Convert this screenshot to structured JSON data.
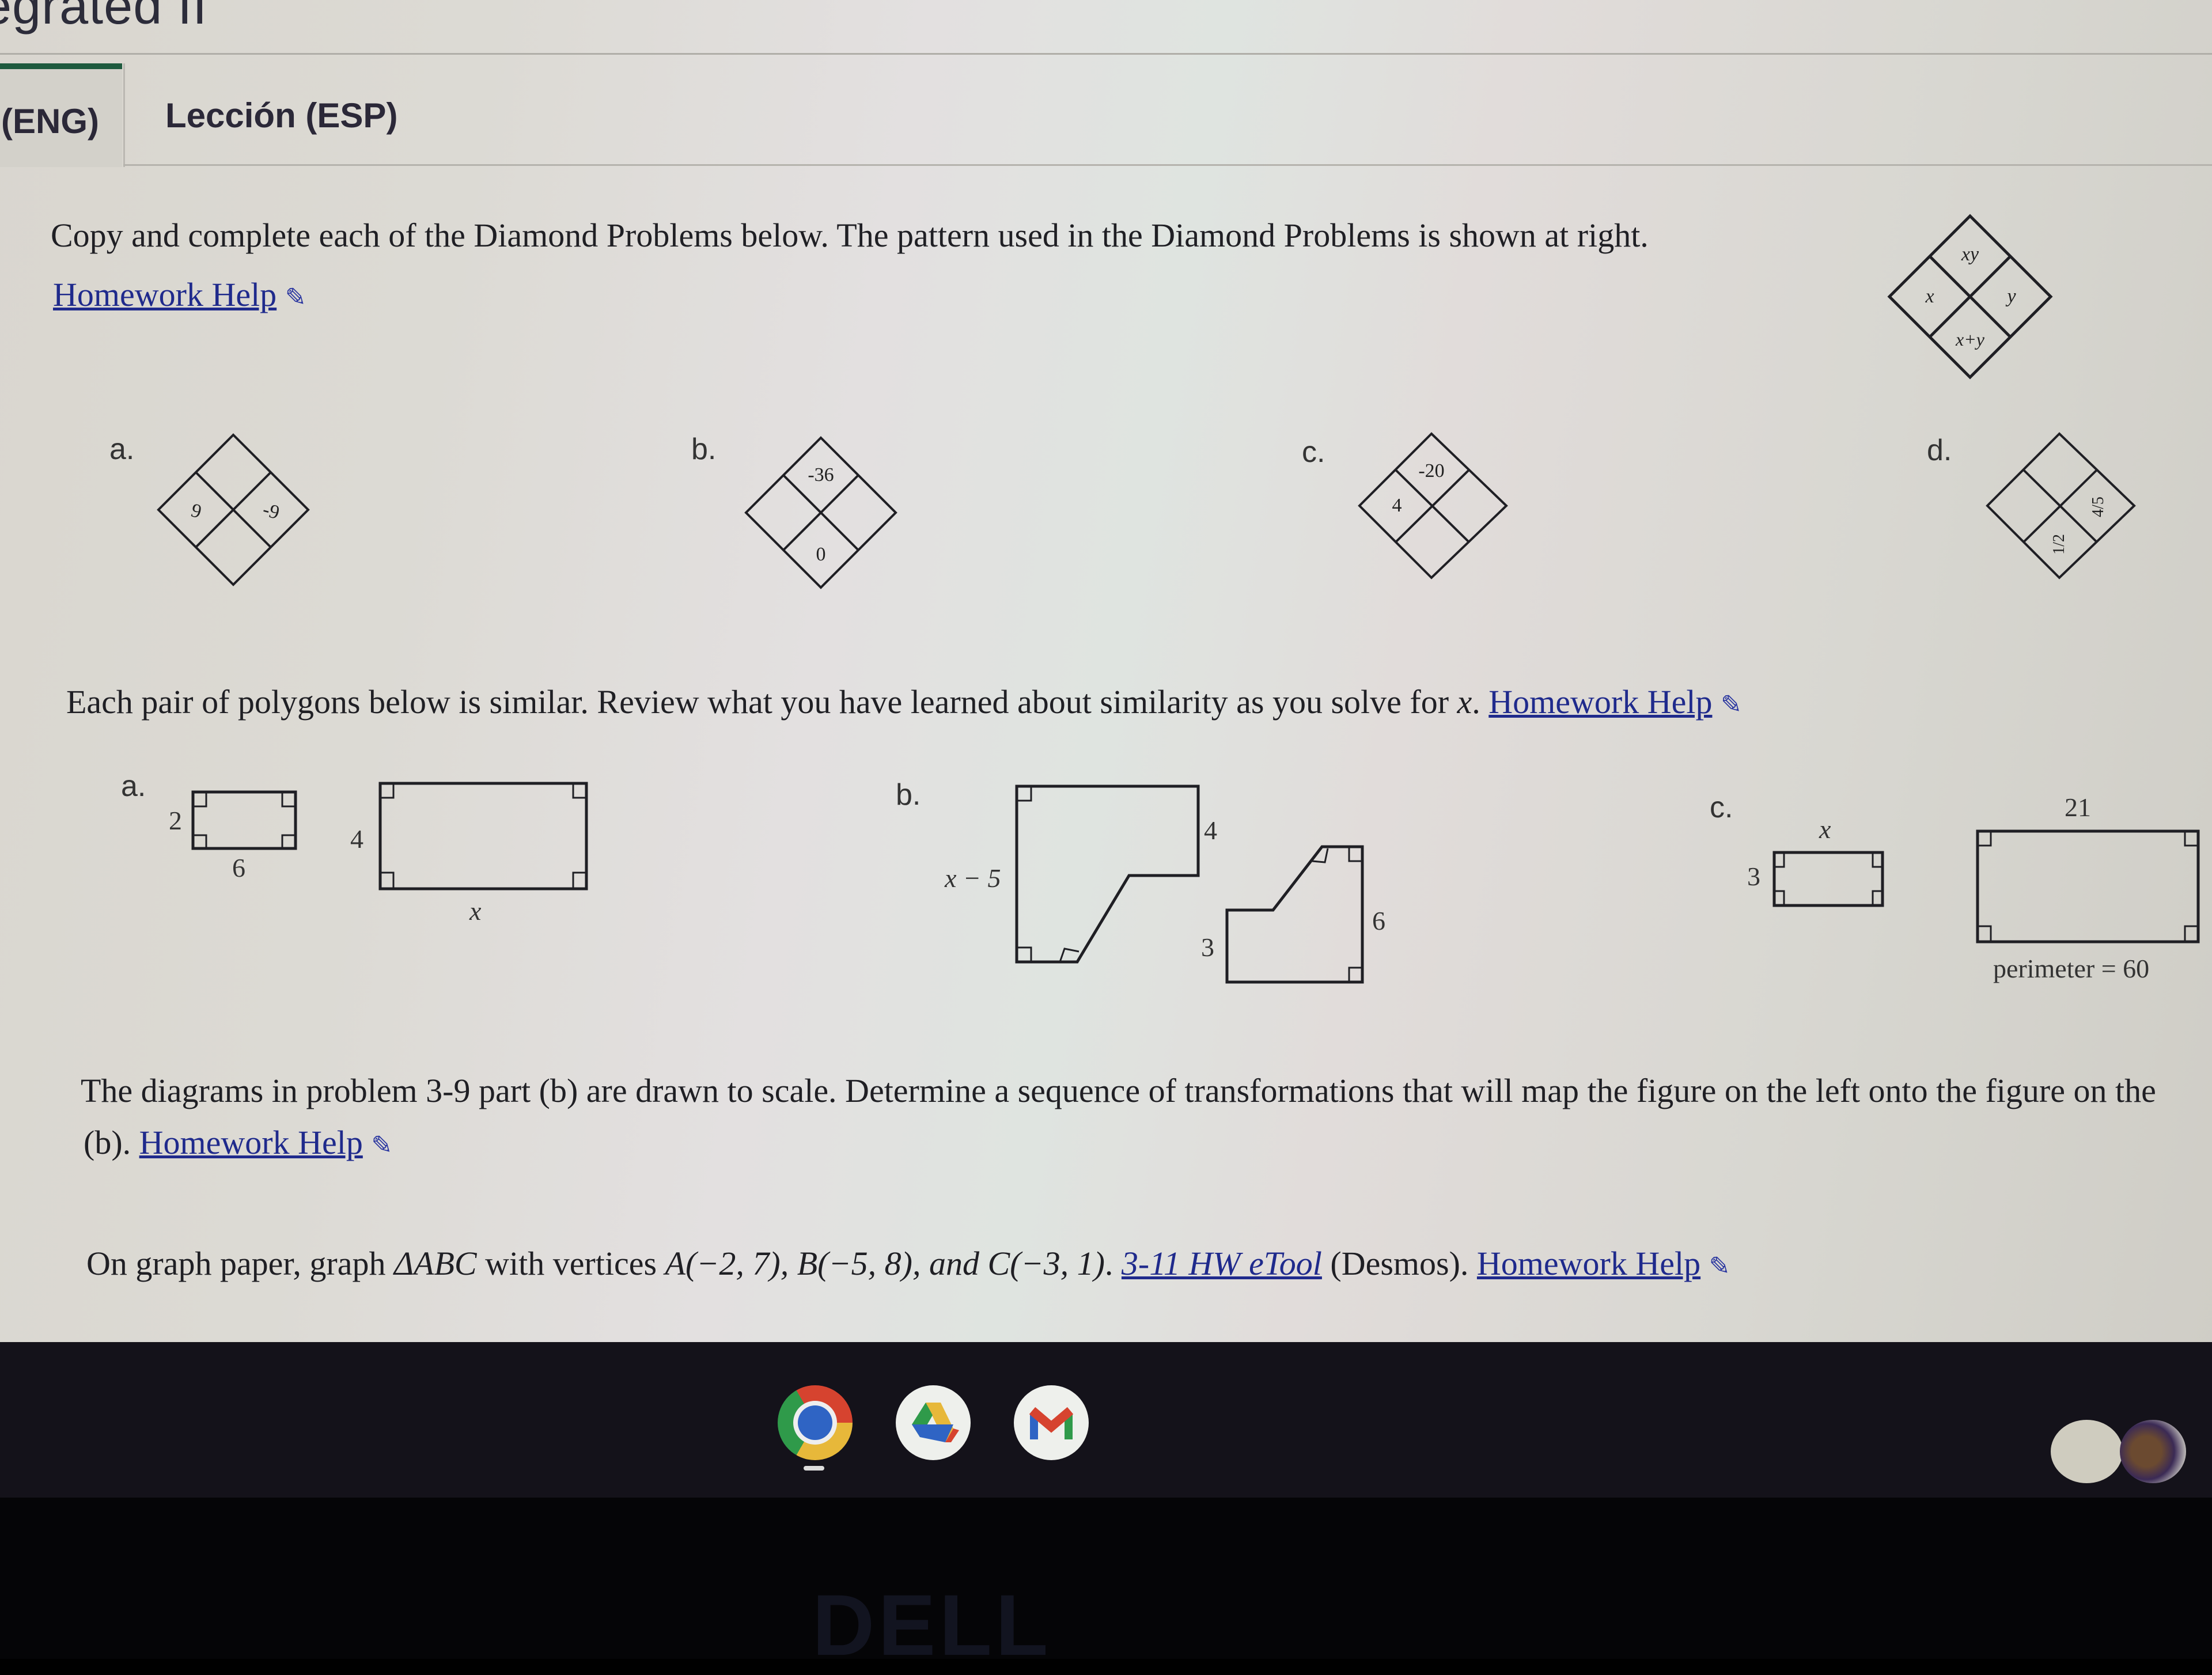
{
  "header": {
    "course_title": "egrated II",
    "tabs": [
      {
        "label": "(ENG)",
        "active": true
      },
      {
        "label": "Lección (ESP)",
        "active": false
      }
    ],
    "accent_color": "#1e5a3e"
  },
  "problems": {
    "diamond": {
      "prompt": "Copy and complete each of the Diamond Problems below. The pattern used in the Diamond Problems is shown at right.",
      "help_link": "Homework Help",
      "pattern": {
        "top": "xy",
        "left": "x",
        "right": "y",
        "bottom": "x+y"
      },
      "parts": [
        {
          "label": "a.",
          "top": "",
          "left": "9",
          "right": "-9",
          "bottom": ""
        },
        {
          "label": "b.",
          "top": "-36",
          "left": "",
          "right": "",
          "bottom": "0"
        },
        {
          "label": "c.",
          "top": "-20",
          "left": "4",
          "right": "",
          "bottom": ""
        },
        {
          "label": "d.",
          "top": "",
          "left": "",
          "right": "4/5",
          "bottom": "1/2"
        }
      ]
    },
    "similarity": {
      "prompt": "Each pair of polygons below is similar. Review what you have learned about similarity as you solve for ",
      "variable": "x",
      "prompt_end": ".",
      "help_link": "Homework Help",
      "parts": [
        {
          "label": "a.",
          "small": {
            "side": "2",
            "bottom": "6"
          },
          "large": {
            "side": "4",
            "bottom": "x"
          }
        },
        {
          "label": "b.",
          "left_figure": {
            "side": "x − 5",
            "right": "4"
          },
          "right_figure": {
            "left": "3",
            "right": "6"
          }
        },
        {
          "label": "c.",
          "small": {
            "side": "3",
            "top": "x"
          },
          "large": {
            "top": "21",
            "caption": "perimeter = 60"
          }
        }
      ]
    },
    "transformations": {
      "prompt": "The diagrams in problem 3-9 part (b) are drawn to scale. Determine a sequence of transformations that will map the figure on the left onto the figure on the",
      "line2_prefix": "(b). ",
      "help_link": "Homework Help"
    },
    "graph": {
      "prompt_start": "On graph paper, graph ",
      "triangle": "ΔABC",
      "prompt_mid": " with vertices ",
      "vertices": "A(−2, 7), B(−5, 8), and C(−3, 1)",
      "prompt_dot": ". ",
      "etool_link": "3-11 HW eTool",
      "etool_suffix": " (Desmos). ",
      "help_link": "Homework Help"
    }
  },
  "shelf": {
    "apps": [
      {
        "name": "Chrome",
        "icon": "chrome-icon",
        "running": true
      },
      {
        "name": "Google Drive",
        "icon": "drive-icon",
        "running": false
      },
      {
        "name": "Gmail",
        "icon": "gmail-icon",
        "running": false
      }
    ]
  },
  "bezel": {
    "brand": "DELL"
  }
}
